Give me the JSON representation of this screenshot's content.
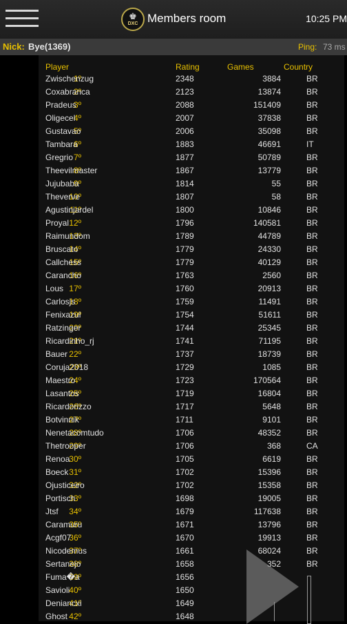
{
  "header": {
    "title": "Members room",
    "time": "10:25 PM",
    "logo_text": "DXC"
  },
  "info": {
    "nick_label": "Nick:",
    "nick_value": "Bye(1369)",
    "ping_label": "Ping:",
    "ping_value": "73 ms"
  },
  "table": {
    "columns": {
      "player": "Player",
      "rating": "Rating",
      "games": "Games",
      "country": "Country"
    },
    "rows": [
      {
        "rank": "1º",
        "name": "Zwischenzug",
        "rating": "2348",
        "games": "3884",
        "country": "BR"
      },
      {
        "rank": "2º",
        "name": "Coxabranca",
        "rating": "2123",
        "games": "13874",
        "country": "BR"
      },
      {
        "rank": "3º",
        "name": "Pradeus",
        "rating": "2088",
        "games": "151409",
        "country": "BR"
      },
      {
        "rank": "4º",
        "name": "Oligecel",
        "rating": "2007",
        "games": "37838",
        "country": "BR"
      },
      {
        "rank": "5º",
        "name": "Gustavao",
        "rating": "2006",
        "games": "35098",
        "country": "BR"
      },
      {
        "rank": "6º",
        "name": "Tambara",
        "rating": "1883",
        "games": "46691",
        "country": "IT"
      },
      {
        "rank": "7º",
        "name": "Gregrio",
        "rating": "1877",
        "games": "50789",
        "country": "BR"
      },
      {
        "rank": "8º",
        "name": "Theevilmaster",
        "rating": "1867",
        "games": "13779",
        "country": "BR"
      },
      {
        "rank": "9º",
        "name": "Jujubaba",
        "rating": "1814",
        "games": "55",
        "country": "BR"
      },
      {
        "rank": "10º",
        "name": "Theverve",
        "rating": "1807",
        "games": "58",
        "country": "BR"
      },
      {
        "rank": "11º",
        "name": "Agustinjardel",
        "rating": "1800",
        "games": "10846",
        "country": "BR"
      },
      {
        "rank": "12º",
        "name": "Proyal",
        "rating": "1796",
        "games": "140581",
        "country": "BR"
      },
      {
        "rank": "13º",
        "name": "Raimundom",
        "rating": "1789",
        "games": "44789",
        "country": "BR"
      },
      {
        "rank": "14º",
        "name": "Bruscato",
        "rating": "1779",
        "games": "24330",
        "country": "BR"
      },
      {
        "rank": "15º",
        "name": "Callchess",
        "rating": "1779",
        "games": "40129",
        "country": "BR"
      },
      {
        "rank": "16º",
        "name": "Carancho",
        "rating": "1763",
        "games": "2560",
        "country": "BR"
      },
      {
        "rank": "17º",
        "name": "Lous",
        "rating": "1760",
        "games": "20913",
        "country": "BR"
      },
      {
        "rank": "18º",
        "name": "Carlosjs",
        "rating": "1759",
        "games": "11491",
        "country": "BR"
      },
      {
        "rank": "19º",
        "name": "Fenixazul",
        "rating": "1754",
        "games": "51611",
        "country": "BR"
      },
      {
        "rank": "20º",
        "name": "Ratzinger",
        "rating": "1744",
        "games": "25345",
        "country": "BR"
      },
      {
        "rank": "21º",
        "name": "Ricardinho_rj",
        "rating": "1741",
        "games": "71195",
        "country": "BR"
      },
      {
        "rank": "22º",
        "name": "Bauer",
        "rating": "1737",
        "games": "18739",
        "country": "BR"
      },
      {
        "rank": "23º",
        "name": "Coruja2018",
        "rating": "1729",
        "games": "1085",
        "country": "BR"
      },
      {
        "rank": "24º",
        "name": "Maestro",
        "rating": "1723",
        "games": "170564",
        "country": "BR"
      },
      {
        "rank": "25º",
        "name": "Lasantos",
        "rating": "1719",
        "games": "16804",
        "country": "BR"
      },
      {
        "rank": "26º",
        "name": "Ricardorizzo",
        "rating": "1717",
        "games": "5648",
        "country": "BR"
      },
      {
        "rank": "27º",
        "name": "Botvinnik",
        "rating": "1711",
        "games": "9101",
        "country": "BR"
      },
      {
        "rank": "28º",
        "name": "Nenetacomtudo",
        "rating": "1706",
        "games": "48352",
        "country": "BR"
      },
      {
        "rank": "29º",
        "name": "Thetrooper",
        "rating": "1706",
        "games": "368",
        "country": "CA"
      },
      {
        "rank": "30º",
        "name": "Renoa",
        "rating": "1705",
        "games": "6619",
        "country": "BR"
      },
      {
        "rank": "31º",
        "name": "Boeck",
        "rating": "1702",
        "games": "15396",
        "country": "BR"
      },
      {
        "rank": "32º",
        "name": "Ojusticeiro",
        "rating": "1702",
        "games": "15358",
        "country": "BR"
      },
      {
        "rank": "33º",
        "name": "Portisch",
        "rating": "1698",
        "games": "19005",
        "country": "BR"
      },
      {
        "rank": "34º",
        "name": "Jtsf",
        "rating": "1679",
        "games": "117638",
        "country": "BR"
      },
      {
        "rank": "35º",
        "name": "Caramuru",
        "rating": "1671",
        "games": "13796",
        "country": "BR"
      },
      {
        "rank": "36º",
        "name": "Acgf07",
        "rating": "1670",
        "games": "19913",
        "country": "BR"
      },
      {
        "rank": "37º",
        "name": "Nicodemus",
        "rating": "1661",
        "games": "68024",
        "country": "BR"
      },
      {
        "rank": "38º",
        "name": "Sertanejo",
        "rating": "1658",
        "games": "352",
        "country": "BR"
      },
      {
        "rank": "39º",
        "name": "Fuma�a",
        "rating": "1656",
        "games": "",
        "country": ""
      },
      {
        "rank": "40º",
        "name": "Savioli",
        "rating": "1650",
        "games": "",
        "country": ""
      },
      {
        "rank": "41º",
        "name": "Deniancxi",
        "rating": "1649",
        "games": "",
        "country": ""
      },
      {
        "rank": "42º",
        "name": "Ghost",
        "rating": "1648",
        "games": "",
        "country": ""
      }
    ]
  },
  "colors": {
    "accent": "#e8c000",
    "background": "#000000",
    "panel": "#121212",
    "text": "#e2e2e2"
  },
  "icons": {
    "menu": "hamburger-icon",
    "logo": "chess-club-logo",
    "play": "play-icon"
  }
}
